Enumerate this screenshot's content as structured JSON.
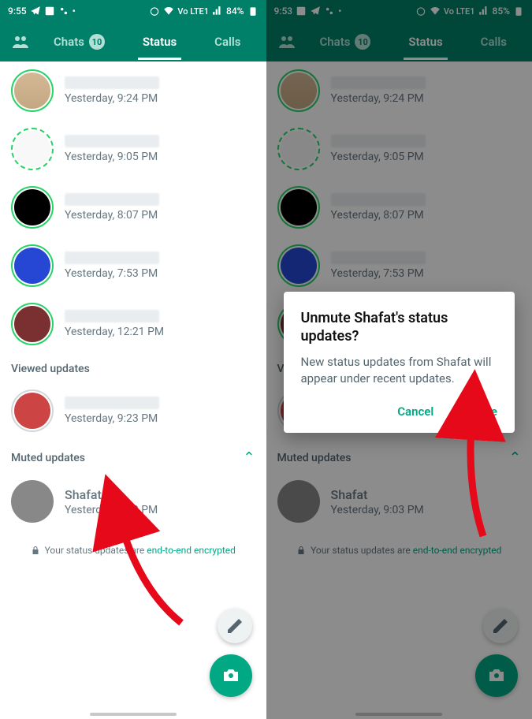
{
  "left": {
    "statusbar": {
      "time": "9:55",
      "battery": "84%",
      "net": "Vo LTE1"
    },
    "tabs": {
      "chats": "Chats",
      "chats_badge": "10",
      "status": "Status",
      "calls": "Calls"
    },
    "rows": [
      {
        "time": "Yesterday, 9:24 PM",
        "ring": "ring",
        "av": "av-bag"
      },
      {
        "time": "Yesterday, 9:05 PM",
        "ring": "ring dashed",
        "av": "av-text"
      },
      {
        "time": "Yesterday, 8:07 PM",
        "ring": "ring",
        "av": "av-black"
      },
      {
        "time": "Yesterday, 7:53 PM",
        "ring": "ring",
        "av": "av-blue"
      },
      {
        "time": "Yesterday, 12:21 PM",
        "ring": "ring",
        "av": "av-mar"
      }
    ],
    "viewed_label": "Viewed updates",
    "viewed": {
      "time": "Yesterday, 9:23 PM"
    },
    "muted_label": "Muted updates",
    "muted": {
      "name": "Shafat",
      "time": "Yesterday, 9:03 PM"
    },
    "enc_pre": "Your status updates are ",
    "enc_link": "end-to-end encrypted"
  },
  "right": {
    "statusbar": {
      "time": "9:53",
      "battery": "85%",
      "net": "Vo LTE1"
    },
    "dialog": {
      "title": "Unmute Shafat's status updates?",
      "body": "New status updates from Shafat will appear under recent updates.",
      "cancel": "Cancel",
      "confirm": "Unmute"
    }
  },
  "colors": {
    "brand": "#008069",
    "accent": "#00a884",
    "ring": "#25d366"
  }
}
